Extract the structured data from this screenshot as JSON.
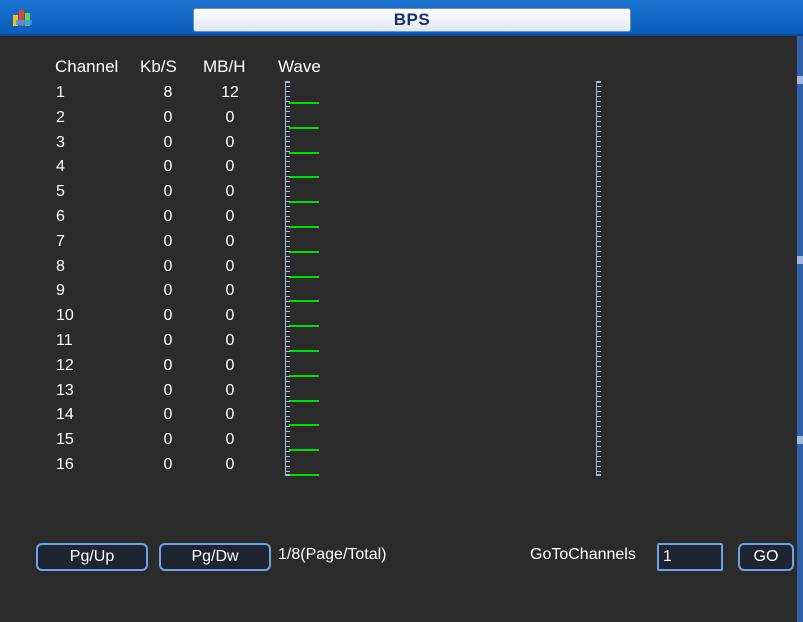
{
  "window": {
    "title": "BPS"
  },
  "headers": {
    "channel": "Channel",
    "kbs": "Kb/S",
    "mbh": "MB/H",
    "wave": "Wave"
  },
  "channels": [
    {
      "channel": "1",
      "kbs": "8",
      "mbh": "12"
    },
    {
      "channel": "2",
      "kbs": "0",
      "mbh": "0"
    },
    {
      "channel": "3",
      "kbs": "0",
      "mbh": "0"
    },
    {
      "channel": "4",
      "kbs": "0",
      "mbh": "0"
    },
    {
      "channel": "5",
      "kbs": "0",
      "mbh": "0"
    },
    {
      "channel": "6",
      "kbs": "0",
      "mbh": "0"
    },
    {
      "channel": "7",
      "kbs": "0",
      "mbh": "0"
    },
    {
      "channel": "8",
      "kbs": "0",
      "mbh": "0"
    },
    {
      "channel": "9",
      "kbs": "0",
      "mbh": "0"
    },
    {
      "channel": "10",
      "kbs": "0",
      "mbh": "0"
    },
    {
      "channel": "11",
      "kbs": "0",
      "mbh": "0"
    },
    {
      "channel": "12",
      "kbs": "0",
      "mbh": "0"
    },
    {
      "channel": "13",
      "kbs": "0",
      "mbh": "0"
    },
    {
      "channel": "14",
      "kbs": "0",
      "mbh": "0"
    },
    {
      "channel": "15",
      "kbs": "0",
      "mbh": "0"
    },
    {
      "channel": "16",
      "kbs": "0",
      "mbh": "0"
    }
  ],
  "footer": {
    "pgup_label": "Pg/Up",
    "pgdw_label": "Pg/Dw",
    "page_info": "1/8(Page/Total)",
    "goto_label": "GoToChannels",
    "goto_value": "1",
    "go_label": "GO"
  },
  "colors": {
    "background": "#2b2b2b",
    "titlebar": "#0a5cb8",
    "wave": "#00e000",
    "button_border": "#6fa3e6"
  },
  "icons": {
    "app": "app-logo-icon"
  }
}
